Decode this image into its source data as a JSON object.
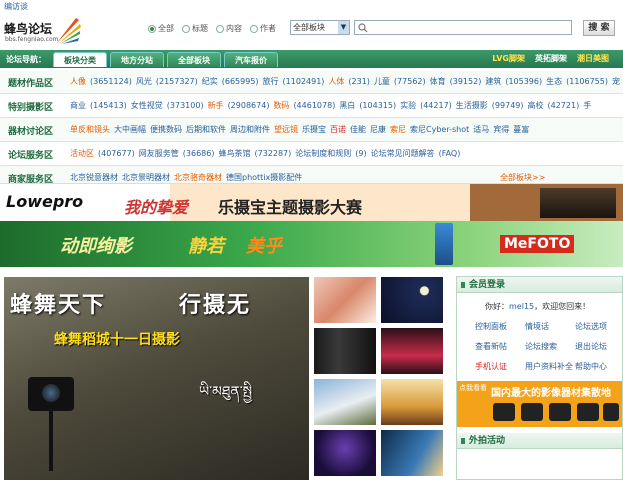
{
  "topbar": {
    "visit_link": "编访谈"
  },
  "logo": {
    "name": "蜂鸟论坛",
    "url_text": "bbs.fengniao.com"
  },
  "search": {
    "radios": [
      {
        "label": "全部",
        "checked": true
      },
      {
        "label": "标题",
        "checked": false
      },
      {
        "label": "内容",
        "checked": false
      },
      {
        "label": "作者",
        "checked": false
      }
    ],
    "board_select": "全部板块",
    "query": "",
    "button": "搜 索"
  },
  "nav": {
    "tabs": [
      "论坛导航：",
      "板块分类",
      "地方分站",
      "全部板块",
      "汽车报价"
    ],
    "right": [
      "LVG脚架",
      "英拓脚架",
      "潮日美图"
    ]
  },
  "boards": [
    {
      "head": "题材作品区",
      "items": [
        {
          "t": "人像",
          "c": "hot"
        },
        {
          "t": "(3651124)"
        },
        {
          "t": "风光"
        },
        {
          "t": "(2157327)"
        },
        {
          "t": "纪实"
        },
        {
          "t": "(665995)"
        },
        {
          "t": "旅行"
        },
        {
          "t": "(1102491)"
        },
        {
          "t": "人体",
          "c": "hot"
        },
        {
          "t": "(231)"
        },
        {
          "t": "儿童"
        },
        {
          "t": "(77562)"
        },
        {
          "t": "体育"
        },
        {
          "t": "(39152)"
        },
        {
          "t": "建筑"
        },
        {
          "t": "(105396)"
        },
        {
          "t": "生态"
        },
        {
          "t": "(1106755)"
        },
        {
          "t": "宠"
        }
      ]
    },
    {
      "head": "特别摄影区",
      "items": [
        {
          "t": "商业"
        },
        {
          "t": "(145413)"
        },
        {
          "t": "女性视觉"
        },
        {
          "t": "(373100)"
        },
        {
          "t": "新手",
          "c": "hot"
        },
        {
          "t": "(2908674)"
        },
        {
          "t": "数码",
          "c": "hot"
        },
        {
          "t": "(4461078)"
        },
        {
          "t": "黑白"
        },
        {
          "t": "(104315)"
        },
        {
          "t": "实验"
        },
        {
          "t": "(44217)"
        },
        {
          "t": "生活摄影"
        },
        {
          "t": "(99749)"
        },
        {
          "t": "高校"
        },
        {
          "t": "(42721)"
        },
        {
          "t": "手"
        }
      ]
    },
    {
      "head": "器材讨论区",
      "items": [
        {
          "t": "单反和镜头",
          "c": "hot"
        },
        {
          "t": "大中画幅"
        },
        {
          "t": "便携数码"
        },
        {
          "t": "后期和软件"
        },
        {
          "t": "周边和附件"
        },
        {
          "t": "望远镜",
          "c": "hot"
        },
        {
          "t": "乐摄宝"
        },
        {
          "t": "百诺",
          "c": "red"
        },
        {
          "t": "佳能"
        },
        {
          "t": "尼康"
        },
        {
          "t": "索尼",
          "c": "hot"
        },
        {
          "t": "索尼Cyber-shot"
        },
        {
          "t": "适马"
        },
        {
          "t": "宾得"
        },
        {
          "t": "蔓富"
        }
      ]
    },
    {
      "head": "论坛服务区",
      "items": [
        {
          "t": "活动区",
          "c": "hot"
        },
        {
          "t": "(407677)"
        },
        {
          "t": "网友服务管"
        },
        {
          "t": "(36686)"
        },
        {
          "t": "蜂鸟茶馆"
        },
        {
          "t": "(732287)"
        },
        {
          "t": "论坛制度和规则"
        },
        {
          "t": "(9)"
        },
        {
          "t": "论坛常见问题解答"
        },
        {
          "t": "(FAQ)"
        }
      ]
    },
    {
      "head": "商家服务区",
      "items": [
        {
          "t": "北京锐意器材"
        },
        {
          "t": "北京景明器材"
        },
        {
          "t": "北京骆奇器材",
          "c": "hot"
        },
        {
          "t": "德国phottix摄影配件"
        }
      ],
      "more": "全部板块>>"
    }
  ],
  "ad1": {
    "brand": "Lowepro",
    "line1": "我的挚爱",
    "line2": "乐摄宝主题摄影大赛"
  },
  "ad2": {
    "line1": "动即绚影",
    "line2": "静若",
    "line3": "美乎",
    "brand": "MeFOTO"
  },
  "feature": {
    "title_a": "蜂舞天下",
    "title_b": "行摄无",
    "subtitle": "蜂舞稻城十一日摄影",
    "tibetan": "ཡི་མཐུན་སྤྱི"
  },
  "member": {
    "title": "会员登录",
    "greeting_prefix": "你好：",
    "username": "mel15",
    "greeting_suffix": "，欢迎您回来！",
    "links": [
      {
        "t": "控制面板",
        "c": ""
      },
      {
        "t": "情境话",
        "c": ""
      },
      {
        "t": "论坛选项",
        "c": ""
      },
      {
        "t": "查看新帖",
        "c": ""
      },
      {
        "t": "论坛搜索",
        "c": ""
      },
      {
        "t": "退出论坛",
        "c": ""
      },
      {
        "t": "手机认证",
        "c": "red"
      },
      {
        "t": "用户资料补全",
        "c": ""
      },
      {
        "t": "帮助中心",
        "c": ""
      }
    ],
    "promo_small": "点我看看",
    "promo_big": "国内最大的影像器材集散地"
  },
  "outdoor": {
    "title": "外拍活动"
  }
}
